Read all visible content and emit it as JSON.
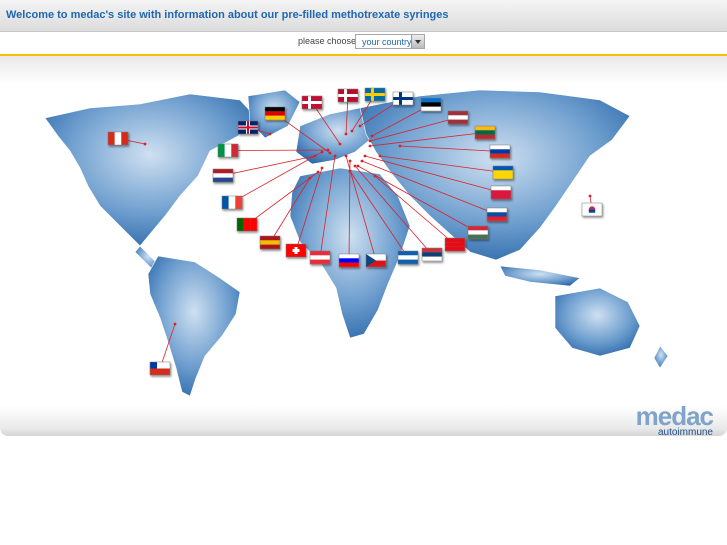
{
  "header": {
    "title": "Welcome to medac's site with information about our pre-filled methotrexate syringes"
  },
  "chooser": {
    "label": "please choose:",
    "select_value": "your country"
  },
  "logo": {
    "brand": "medac",
    "sub": "autoimmune"
  },
  "colors": {
    "title": "#1f67b0",
    "accent_line": "#f1c400",
    "map_blue": "#2f6fb0",
    "link_line": "#d8222a"
  },
  "flags": [
    {
      "name": "canada",
      "colors": [
        "#d52b1e",
        "#ffffff",
        "#d52b1e"
      ],
      "orient": "v"
    },
    {
      "name": "united-kingdom",
      "colors": [
        "#012169",
        "#c8102e",
        "#012169"
      ],
      "orient": "uk"
    },
    {
      "name": "germany",
      "colors": [
        "#000000",
        "#dd0000",
        "#ffce00"
      ],
      "orient": "h"
    },
    {
      "name": "denmark",
      "colors": [
        "#c60c30",
        "#ffffff",
        "#c60c30"
      ],
      "orient": "cross"
    },
    {
      "name": "norway",
      "colors": [
        "#ba0c2f",
        "#ffffff",
        "#00205b"
      ],
      "orient": "cross"
    },
    {
      "name": "sweden",
      "colors": [
        "#006aa7",
        "#fecc02",
        "#006aa7"
      ],
      "orient": "cross"
    },
    {
      "name": "finland",
      "colors": [
        "#ffffff",
        "#003580",
        "#ffffff"
      ],
      "orient": "cross"
    },
    {
      "name": "estonia",
      "colors": [
        "#0072ce",
        "#000000",
        "#ffffff"
      ],
      "orient": "h"
    },
    {
      "name": "latvia",
      "colors": [
        "#9e3039",
        "#ffffff",
        "#9e3039"
      ],
      "orient": "h"
    },
    {
      "name": "lithuania",
      "colors": [
        "#fdb913",
        "#006a44",
        "#c1272d"
      ],
      "orient": "h"
    },
    {
      "name": "russia",
      "colors": [
        "#ffffff",
        "#0039a6",
        "#d52b1e"
      ],
      "orient": "h"
    },
    {
      "name": "ukraine",
      "colors": [
        "#0057b7",
        "#ffd700",
        "#ffd700"
      ],
      "orient": "h"
    },
    {
      "name": "poland",
      "colors": [
        "#ffffff",
        "#dc143c",
        "#dc143c"
      ],
      "orient": "h"
    },
    {
      "name": "slovakia",
      "colors": [
        "#ffffff",
        "#0b4ea2",
        "#ee1c25"
      ],
      "orient": "h"
    },
    {
      "name": "hungary",
      "colors": [
        "#ce2939",
        "#ffffff",
        "#477050"
      ],
      "orient": "h"
    },
    {
      "name": "turkey",
      "colors": [
        "#e30a17",
        "#e30a17",
        "#e30a17"
      ],
      "orient": "h"
    },
    {
      "name": "serbia",
      "colors": [
        "#c6363c",
        "#0c4076",
        "#ffffff"
      ],
      "orient": "h"
    },
    {
      "name": "greece",
      "colors": [
        "#0d5eaf",
        "#ffffff",
        "#0d5eaf"
      ],
      "orient": "h"
    },
    {
      "name": "czech-republic",
      "colors": [
        "#ffffff",
        "#d7141a",
        "#11457e"
      ],
      "orient": "tri"
    },
    {
      "name": "slovenia",
      "colors": [
        "#ffffff",
        "#0000ff",
        "#ff0000"
      ],
      "orient": "h"
    },
    {
      "name": "austria",
      "colors": [
        "#ed2939",
        "#ffffff",
        "#ed2939"
      ],
      "orient": "h"
    },
    {
      "name": "switzerland",
      "colors": [
        "#ff0000",
        "#ffffff",
        "#ff0000"
      ],
      "orient": "swiss"
    },
    {
      "name": "spain",
      "colors": [
        "#aa151b",
        "#f1bf00",
        "#aa151b"
      ],
      "orient": "h"
    },
    {
      "name": "portugal",
      "colors": [
        "#006600",
        "#ff0000",
        "#ff0000"
      ],
      "orient": "v"
    },
    {
      "name": "france",
      "colors": [
        "#0055a4",
        "#ffffff",
        "#ef4135"
      ],
      "orient": "v"
    },
    {
      "name": "netherlands",
      "colors": [
        "#ae1c28",
        "#ffffff",
        "#21468b"
      ],
      "orient": "h"
    },
    {
      "name": "italy",
      "colors": [
        "#009246",
        "#ffffff",
        "#ce2b37"
      ],
      "orient": "v"
    },
    {
      "name": "south-korea",
      "colors": [
        "#ffffff",
        "#cd2e3a",
        "#0047a0"
      ],
      "orient": "korea"
    },
    {
      "name": "chile",
      "colors": [
        "#ffffff",
        "#d52b1e",
        "#0039a6"
      ],
      "orient": "chile"
    }
  ]
}
